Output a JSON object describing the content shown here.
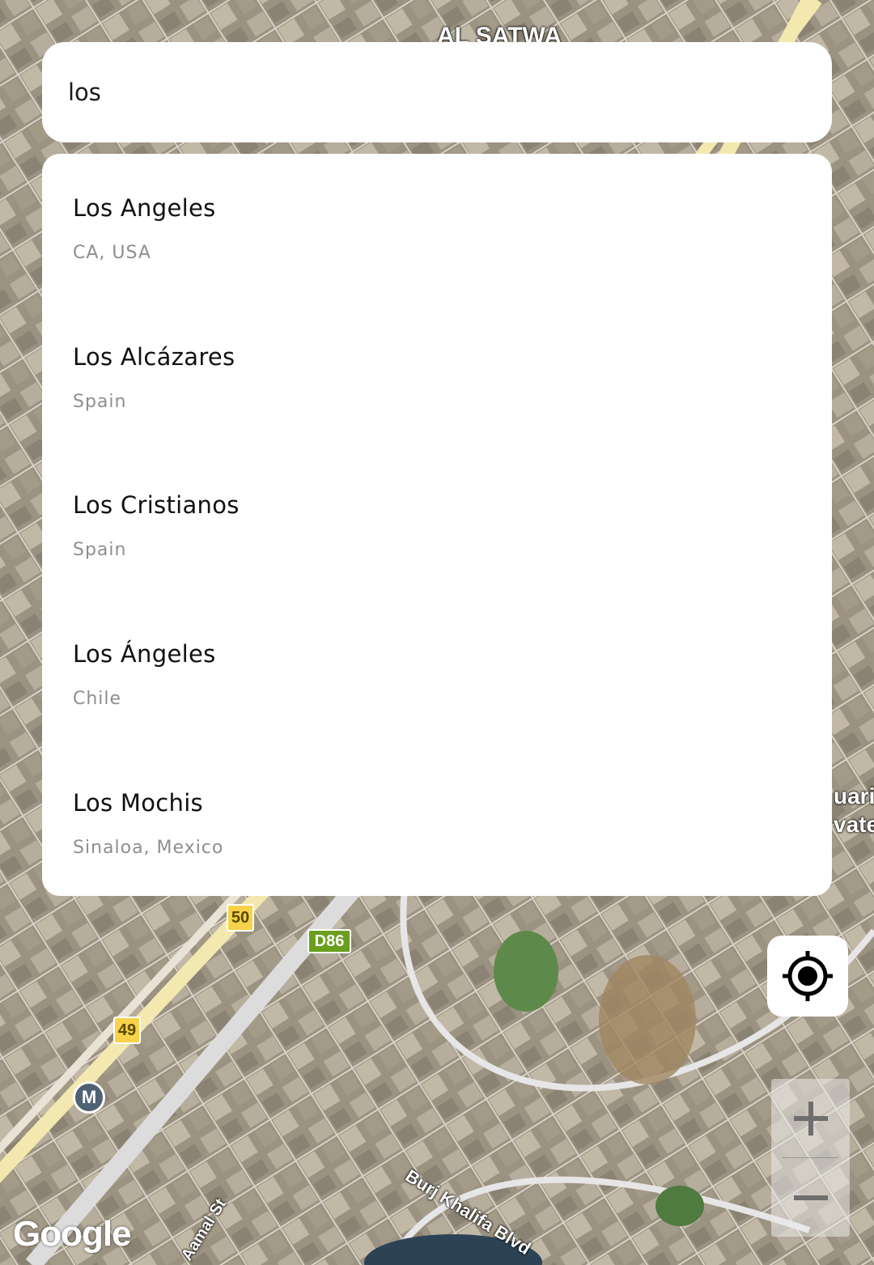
{
  "search": {
    "value": "los",
    "placeholder": ""
  },
  "results": [
    {
      "name": "Los Angeles",
      "region": "CA, USA"
    },
    {
      "name": "Los Alcázares",
      "region": "Spain"
    },
    {
      "name": "Los Cristianos",
      "region": "Spain"
    },
    {
      "name": "Los Ángeles",
      "region": "Chile"
    },
    {
      "name": "Los Mochis",
      "region": "Sinaloa, Mexico"
    }
  ],
  "map": {
    "labels": {
      "district": "AL SATWA",
      "street_burj": "Burj Khalifa Blvd",
      "street_aamal": "Aamal St",
      "partial_right_1": "uari",
      "partial_right_2": "vate"
    },
    "shields": {
      "route_50": "50",
      "route_49": "49",
      "route_d86": "D86",
      "metro": "M"
    },
    "attribution": "Google"
  },
  "controls": {
    "locate_icon": "my-location-icon",
    "zoom_in_icon": "plus-icon",
    "zoom_out_icon": "minus-icon"
  }
}
